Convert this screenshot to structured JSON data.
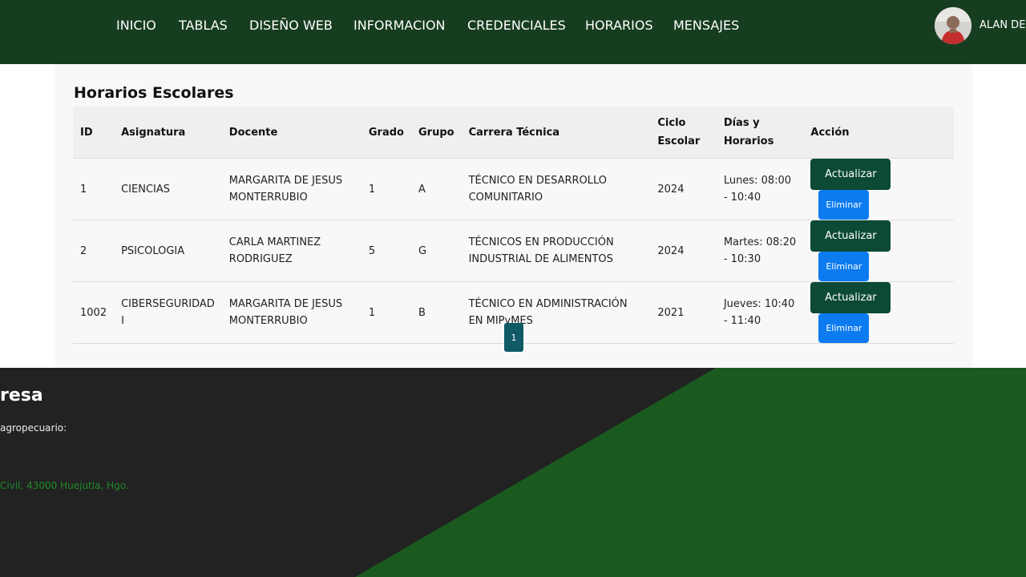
{
  "nav": {
    "links": [
      "INICIO",
      "TABLAS",
      "DISEÑO WEB",
      "INFORMACION",
      "CREDENCIALES",
      "HORARIOS",
      "MENSAJES"
    ],
    "user_name": "ALAN DE"
  },
  "schedule": {
    "title": "Horarios Escolares",
    "headers": {
      "id": "ID",
      "asignatura": "Asignatura",
      "docente": "Docente",
      "grado": "Grado",
      "grupo": "Grupo",
      "carrera": "Carrera Técnica",
      "ciclo": "Ciclo Escolar",
      "dias": "Días y Horarios",
      "accion": "Acción"
    },
    "rows": [
      {
        "id": "1",
        "asignatura": "CIENCIAS",
        "docente": "MARGARITA DE JESUS MONTERRUBIO",
        "grado": "1",
        "grupo": "A",
        "carrera": "TÉCNICO EN DESARROLLO COMUNITARIO",
        "ciclo": "2024",
        "dias": "Lunes: 08:00 - 10:40"
      },
      {
        "id": "2",
        "asignatura": "PSICOLOGIA",
        "docente": "CARLA MARTINEZ RODRIGUEZ",
        "grado": "5",
        "grupo": "G",
        "carrera": "TÉCNICOS EN PRODUCCIÓN INDUSTRIAL DE ALIMENTOS",
        "ciclo": "2024",
        "dias": "Martes: 08:20 - 10:30"
      },
      {
        "id": "1002",
        "asignatura": "CIBERSEGURIDAD I",
        "docente": "MARGARITA DE JESUS MONTERRUBIO",
        "grado": "1",
        "grupo": "B",
        "carrera": "TÉCNICO EN ADMINISTRACIÓN EN MIPyMES",
        "ciclo": "2021",
        "dias": "Jueves: 10:40 - 11:40"
      }
    ],
    "update_label": "Actualizar",
    "delete_label": "Eliminar",
    "page": "1"
  },
  "footer": {
    "title": "resa",
    "text": "agropecuario:",
    "address": "Civil, 43000 Huejutla, Hgo."
  },
  "colors": {
    "navbar": "#173d20",
    "update_button": "#0c4a35",
    "delete_button": "#0d7bf0",
    "pagination": "#0f5a66",
    "footer_dark": "#222222",
    "footer_green": "#1a5a1f",
    "footer_link": "#1f8a2a"
  }
}
